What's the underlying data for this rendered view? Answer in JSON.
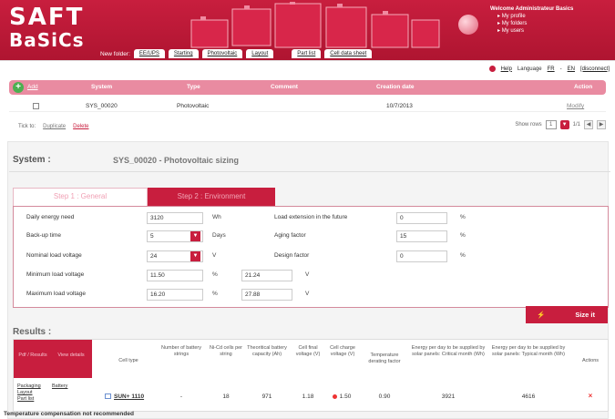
{
  "header": {
    "logo_line1": "SAFT",
    "logo_line2": "BaSiCs",
    "welcome": "Welcome Administrateur Basics",
    "welcome_links": [
      "My profile",
      "My folders",
      "My users"
    ],
    "new_folder_label": "New folder:",
    "tabs": [
      "EE/UPS",
      "Starting",
      "Photovoltaic",
      "Layout",
      "Part list",
      "Cell data sheet"
    ],
    "help": "Help",
    "language_label": "Language",
    "lang_fr": "FR",
    "lang_en": "EN",
    "disconnect": "[disconnect]"
  },
  "systems_table": {
    "add_label": "Add",
    "columns": {
      "system": "System",
      "type": "Type",
      "comment": "Comment",
      "creation_date": "Creation date",
      "action": "Action"
    },
    "row": {
      "system": "SYS_00020",
      "type": "Photovoltaic",
      "comment": "",
      "creation_date": "10/7/2013",
      "action": "Modify"
    },
    "tick_label": "Tick to:",
    "duplicate": "Duplicate",
    "delete": "Delete",
    "show_rows_label": "Show rows",
    "show_rows_value": "1",
    "page_info": "1/1"
  },
  "system_panel": {
    "title": "System :",
    "subtitle": "SYS_00020 - Photovoltaic sizing",
    "step1": "Step 1 : General",
    "step2": "Step 2 : Environment"
  },
  "form": {
    "daily_energy": {
      "label": "Daily energy need",
      "value": "3120",
      "unit": "Wh"
    },
    "backup_time": {
      "label": "Back-up time",
      "value": "5",
      "unit": "Days"
    },
    "nominal_voltage": {
      "label": "Nominal load voltage",
      "value": "24",
      "unit": "V"
    },
    "min_voltage": {
      "label": "Minimum load voltage",
      "value": "11.50",
      "unit": "%",
      "value2": "21.24",
      "unit2": "V"
    },
    "max_voltage": {
      "label": "Maximum load voltage",
      "value": "16.20",
      "unit": "%",
      "value2": "27.88",
      "unit2": "V"
    },
    "load_extension": {
      "label": "Load extension in the future",
      "value": "0",
      "unit": "%"
    },
    "aging_factor": {
      "label": "Aging factor",
      "value": "15",
      "unit": "%"
    },
    "design_factor": {
      "label": "Design factor",
      "value": "0",
      "unit": "%"
    }
  },
  "size_button": "Size it",
  "results": {
    "title": "Results :",
    "side_headers": [
      "Pdf / Results",
      "View details"
    ],
    "columns": [
      "Cell type",
      "Number of battery strings",
      "Ni-Cd cells per string",
      "Theoritical battery capacity (Ah)",
      "Cell final voltage (V)",
      "Cell charge voltage (V)",
      "Temperature derating factor",
      "Energy per day to be supplied by solar panels: Critical month (Wh)",
      "Energy per day to be supplied by solar panels: Typical month (Wh)",
      "Actions"
    ],
    "side_links": [
      "Packaging",
      "Layout",
      "Part list"
    ],
    "battery_link": "Battery",
    "row": {
      "cell_type": "SUN+ 1110",
      "strings": "-",
      "cells": "18",
      "capacity": "971",
      "final_voltage": "1.18",
      "charge_voltage": "1.50",
      "derating": "0.90",
      "critical": "3921",
      "typical": "4616",
      "action": "×"
    },
    "warning": "Temperature compensation not recommended"
  },
  "colors": {
    "brand": "#c81e3e",
    "header_pink": "#e98ba1"
  }
}
